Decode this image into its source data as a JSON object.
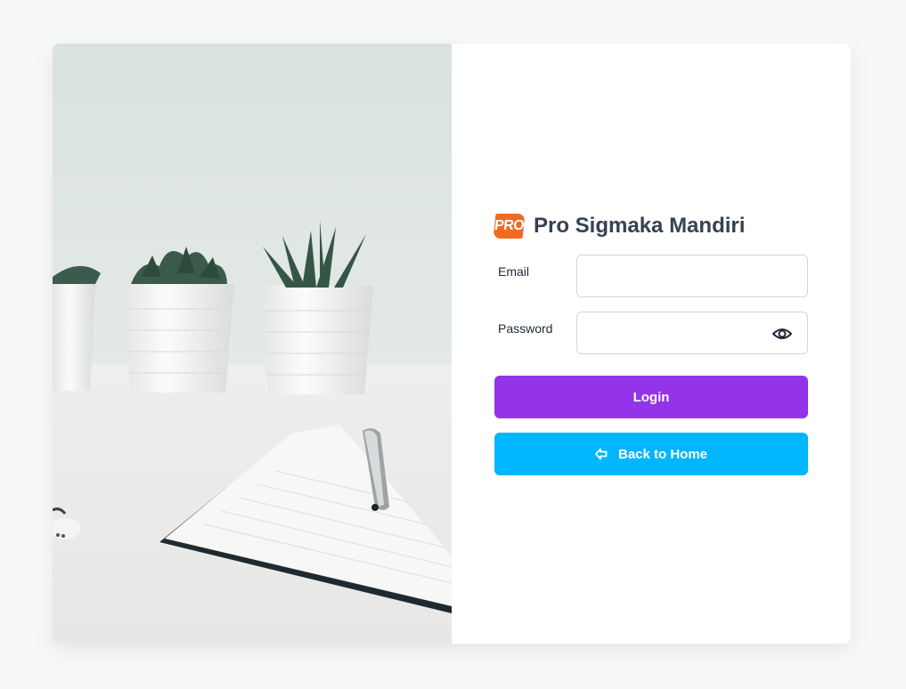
{
  "brand": {
    "logo_text": "PRO",
    "title": "Pro Sigmaka Mandiri"
  },
  "form": {
    "email_label": "Email",
    "email_value": "",
    "password_label": "Password",
    "password_value": "",
    "show_password_icon": "eye-icon"
  },
  "actions": {
    "login_label": "Login",
    "home_label": "Back to Home",
    "home_icon": "arrow-left-icon"
  },
  "colors": {
    "login_button": "#9333ea",
    "home_button": "#00b6ff",
    "logo": "#f26a21",
    "title_text": "#374151"
  }
}
